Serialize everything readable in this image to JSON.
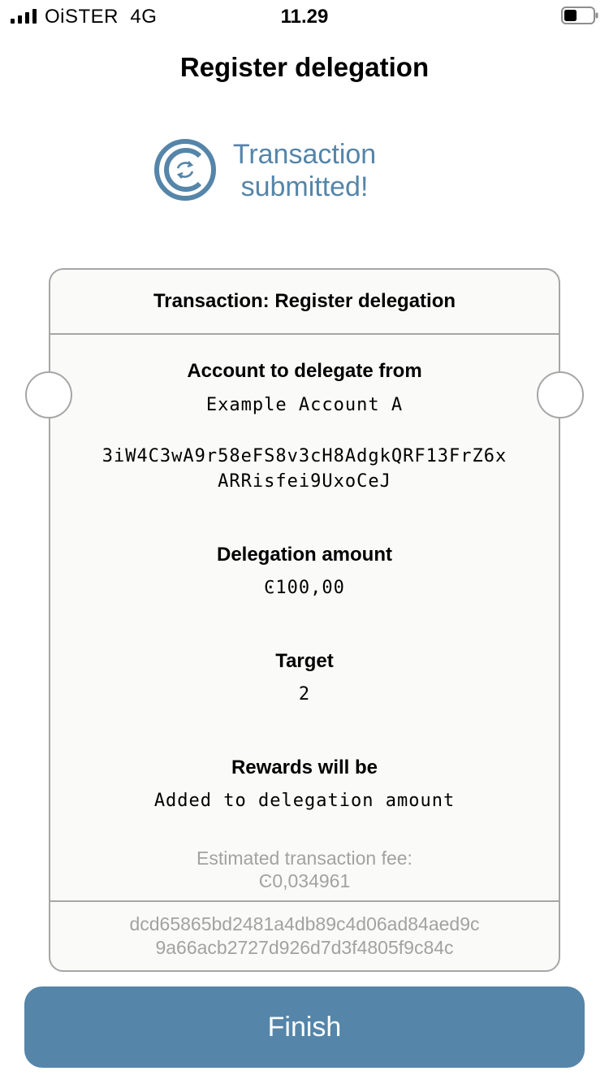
{
  "status_bar": {
    "carrier": "OiSTER",
    "network": "4G",
    "time": "11.29"
  },
  "page_title": "Register delegation",
  "banner": {
    "line1": "Transaction",
    "line2": "submitted!",
    "icon": "concordium-logo-icon"
  },
  "ticket": {
    "header": "Transaction: Register delegation",
    "account_label": "Account to delegate from",
    "account_name": "Example Account A",
    "account_address_line1": "3iW4C3wA9r58eFS8v3cH8AdgkQRF13FrZ6x",
    "account_address_line2": "ARRisfei9UxoCeJ",
    "amount_label": "Delegation amount",
    "amount_value": "Ͼ100,00",
    "target_label": "Target",
    "target_value": "2",
    "rewards_label": "Rewards will be",
    "rewards_value": "Added to delegation amount",
    "fee_label": "Estimated transaction fee:",
    "fee_value": "Ͼ0,034961",
    "hash_line1": "dcd65865bd2481a4db89c4d06ad84aed9c",
    "hash_line2": "9a66acb2727d926d7d3f4805f9c84c"
  },
  "finish_button": "Finish",
  "colors": {
    "accent": "#5585a9",
    "ticket_bg": "#fafaf9",
    "border": "#a6a6a6",
    "muted_text": "#a2a2a2"
  }
}
